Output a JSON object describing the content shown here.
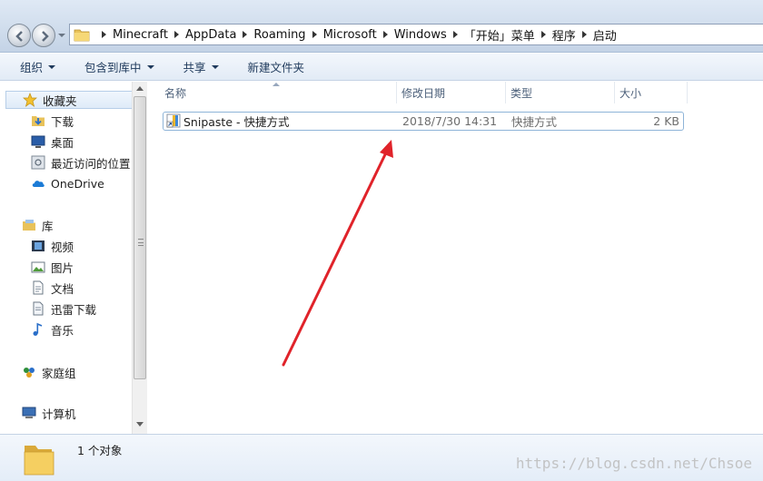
{
  "address": {
    "crumbs": [
      "Minecraft",
      "AppData",
      "Roaming",
      "Microsoft",
      "Windows",
      "「开始」菜单",
      "程序",
      "启动"
    ]
  },
  "toolbar": {
    "organize": "组织",
    "include_in_library": "包含到库中",
    "share": "共享",
    "new_folder": "新建文件夹"
  },
  "nav": {
    "favorites": "收藏夹",
    "downloads": "下载",
    "desktop": "桌面",
    "recent": "最近访问的位置",
    "onedrive": "OneDrive",
    "libraries": "库",
    "videos": "视频",
    "pictures": "图片",
    "documents": "文档",
    "xunlei": "迅雷下载",
    "music": "音乐",
    "homegroup": "家庭组",
    "computer": "计算机"
  },
  "columns": {
    "name": "名称",
    "date": "修改日期",
    "type": "类型",
    "size": "大小"
  },
  "files": [
    {
      "name": "Snipaste - 快捷方式",
      "date": "2018/7/30 14:31",
      "type": "快捷方式",
      "size": "2 KB"
    }
  ],
  "status": {
    "count": "1 个对象"
  },
  "watermark": "https://blog.csdn.net/Chsoe",
  "colors": {
    "annotation_arrow": "#e0232a",
    "selection_border": "#8eb4d8"
  }
}
